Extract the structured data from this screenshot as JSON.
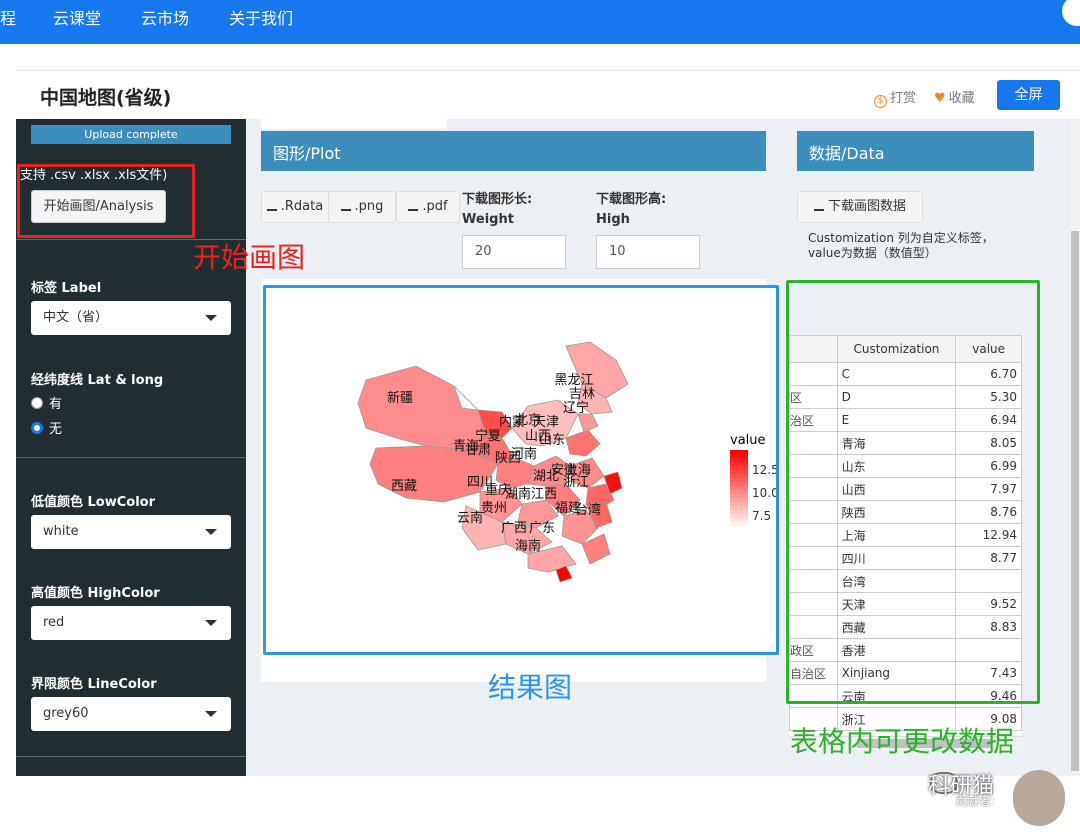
{
  "topnav": {
    "items": [
      "程",
      "云课堂",
      "云市场",
      "关于我们"
    ]
  },
  "header": {
    "title": "中国地图(省级)",
    "reward": "打赏",
    "favorite": "收藏",
    "fullscreen": "全屏"
  },
  "sidebar": {
    "upload_status": "Upload complete",
    "file_types": "支持 .csv .xlsx .xls文件)",
    "analysis_button": "开始画图/Analysis",
    "label_title": "标签 Label",
    "label_value": "中文（省）",
    "latlong_title": "经纬度线 Lat & long",
    "radio_yes": "有",
    "radio_no": "无",
    "low_title": "低值颜色 LowColor",
    "low_value": "white",
    "high_title": "高值颜色 HighColor",
    "high_value": "red",
    "line_title": "界限颜色 LineColor",
    "line_value": "grey60"
  },
  "plot_panel": {
    "title": "图形/Plot",
    "dl_rdata": ".Rdata",
    "dl_png": ".png",
    "dl_pdf": ".pdf",
    "width_label": "下载图形长:",
    "width_sub": "Weight",
    "width_value": "20",
    "height_label": "下载图形高:",
    "height_sub": "High",
    "height_value": "10"
  },
  "map": {
    "legend_title": "value",
    "legend_ticks": [
      "12.5",
      "10.0",
      "7.5"
    ],
    "labels": [
      "黑龙江",
      "吉林",
      "辽宁",
      "新疆",
      "内蒙",
      "天津",
      "宁夏",
      "山西",
      "山东",
      "青海",
      "甘肃",
      "陕西",
      "河南",
      "西藏",
      "四川",
      "重庆",
      "湖北",
      "安徽",
      "上海",
      "浙江",
      "湖南",
      "江西",
      "贵州",
      "福建",
      "台湾",
      "云南",
      "广西",
      "广东",
      "海南",
      "北京"
    ],
    "color_low": "#ffffff",
    "color_high": "#ff0000"
  },
  "data_panel": {
    "title": "数据/Data",
    "download": "下载画图数据",
    "note": "Customization 列为自定义标签，value为数据（数值型）",
    "col_index": "",
    "col_custom": "Customization",
    "col_value": "value",
    "rows": [
      [
        "",
        "C",
        "6.70"
      ],
      [
        "区",
        "D",
        "5.30"
      ],
      [
        "治区",
        "E",
        "6.94"
      ],
      [
        "",
        "青海",
        "8.05"
      ],
      [
        "",
        "山东",
        "6.99"
      ],
      [
        "",
        "山西",
        "7.97"
      ],
      [
        "",
        "陕西",
        "8.76"
      ],
      [
        "",
        "上海",
        "12.94"
      ],
      [
        "",
        "四川",
        "8.77"
      ],
      [
        "",
        "台湾",
        ""
      ],
      [
        "",
        "天津",
        "9.52"
      ],
      [
        "",
        "西藏",
        "8.83"
      ],
      [
        "政区",
        "香港",
        ""
      ],
      [
        "自治区",
        "Xinjiang",
        "7.43"
      ],
      [
        "",
        "云南",
        "9.46"
      ],
      [
        "",
        "浙江",
        "9.08"
      ]
    ]
  },
  "annotations": {
    "start": "开始画图",
    "result": "结果图",
    "editable": "表格内可更改数据"
  },
  "watermark": {
    "name": "科研猫",
    "contributor": "贡献者:"
  }
}
